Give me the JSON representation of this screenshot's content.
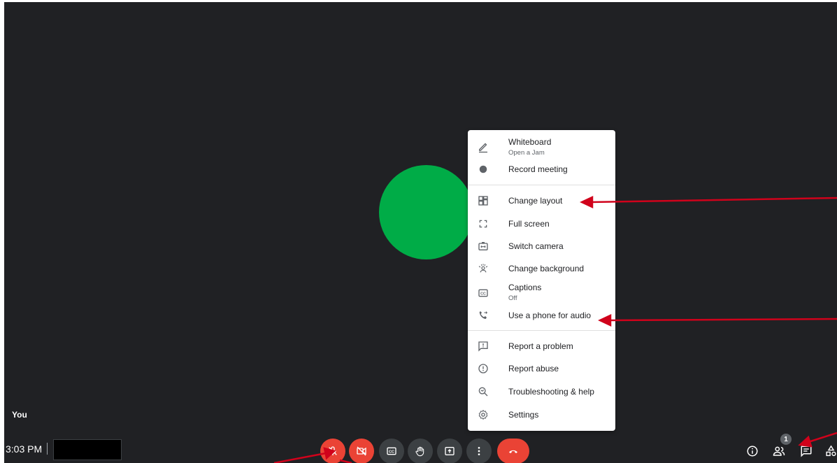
{
  "you_label": "You",
  "time": "3:03 PM",
  "participants_badge": "1",
  "colors": {
    "background": "#202124",
    "avatar": "#00ac47",
    "danger": "#ea4335",
    "control": "#3c4043",
    "annotation": "#d0021b"
  },
  "menu": {
    "whiteboard": {
      "label": "Whiteboard",
      "sub": "Open a Jam",
      "icon": "pen-icon"
    },
    "record": {
      "label": "Record meeting",
      "icon": "record-dot-icon"
    },
    "layout": {
      "label": "Change layout",
      "icon": "layout-grid-icon"
    },
    "fullscreen": {
      "label": "Full screen",
      "icon": "fullscreen-icon"
    },
    "switch_camera": {
      "label": "Switch camera",
      "icon": "switch-camera-icon"
    },
    "background": {
      "label": "Change background",
      "icon": "background-effect-icon"
    },
    "captions": {
      "label": "Captions",
      "sub": "Off",
      "icon": "cc-icon"
    },
    "phone_audio": {
      "label": "Use a phone for audio",
      "icon": "phone-forward-icon"
    },
    "report_problem": {
      "label": "Report a problem",
      "icon": "feedback-icon"
    },
    "report_abuse": {
      "label": "Report abuse",
      "icon": "alert-circle-icon"
    },
    "troubleshooting": {
      "label": "Troubleshooting & help",
      "icon": "help-search-icon"
    },
    "settings": {
      "label": "Settings",
      "icon": "gear-icon"
    }
  },
  "controls": [
    "mic-off-icon",
    "camera-off-icon",
    "cc-icon",
    "raise-hand-icon",
    "present-icon",
    "more-vert-icon",
    "hangup-icon"
  ],
  "right_controls": [
    "info-icon",
    "people-icon",
    "chat-icon",
    "activities-icon"
  ]
}
